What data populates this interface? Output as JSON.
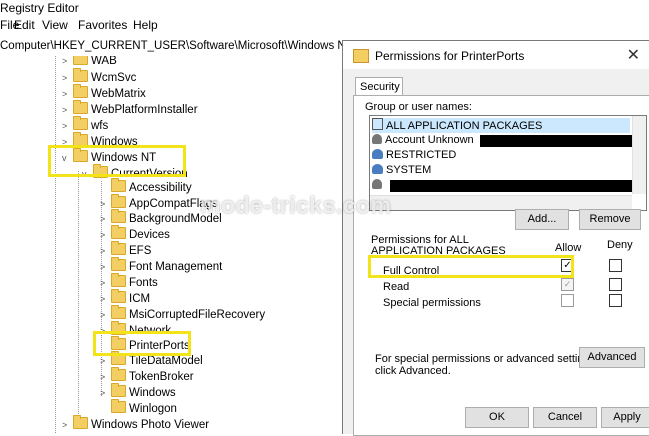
{
  "window": {
    "title": "Registry Editor"
  },
  "menu": [
    "File",
    "Edit",
    "View",
    "Favorites",
    "Help"
  ],
  "address": "Computer\\HKEY_CURRENT_USER\\Software\\Microsoft\\Windows NT\\CurrentVersion\\PrinterPorts",
  "tree": {
    "items": [
      {
        "label": "WAB"
      },
      {
        "label": "WcmSvc"
      },
      {
        "label": "WebMatrix"
      },
      {
        "label": "WebPlatformInstaller"
      },
      {
        "label": "wfs"
      },
      {
        "label": "Windows"
      },
      {
        "label": "Windows NT"
      },
      {
        "label": "CurrentVersion"
      },
      {
        "label": "Accessibility"
      },
      {
        "label": "AppCompatFlags"
      },
      {
        "label": "BackgroundModel"
      },
      {
        "label": "Devices"
      },
      {
        "label": "EFS"
      },
      {
        "label": "Font Management"
      },
      {
        "label": "Fonts"
      },
      {
        "label": "ICM"
      },
      {
        "label": "MsiCorruptedFileRecovery"
      },
      {
        "label": "Network"
      },
      {
        "label": "PrinterPorts"
      },
      {
        "label": "TileDataModel"
      },
      {
        "label": "TokenBroker"
      },
      {
        "label": "Windows"
      },
      {
        "label": "Winlogon"
      },
      {
        "label": "Windows Photo Viewer"
      }
    ]
  },
  "dialog": {
    "title": "Permissions for PrinterPorts",
    "tab": "Security",
    "group_label": "Group or user names:",
    "users": [
      {
        "name": "ALL APPLICATION PACKAGES"
      },
      {
        "name": "Account Unknown"
      },
      {
        "name": "RESTRICTED"
      },
      {
        "name": "SYSTEM"
      },
      {
        "name": ""
      }
    ],
    "add_button": "Add...",
    "remove_button": "Remove",
    "perm_label_1": "Permissions for ALL",
    "perm_label_2": "APPLICATION PACKAGES",
    "allow_header": "Allow",
    "deny_header": "Deny",
    "permissions": [
      {
        "name": "Full Control",
        "allow": true,
        "deny": false
      },
      {
        "name": "Read",
        "allow": true,
        "deny": false
      },
      {
        "name": "Special permissions",
        "allow": false,
        "deny": false
      }
    ],
    "advanced_text_1": "For special permissions or advanced settings,",
    "advanced_text_2": "click Advanced.",
    "advanced_button": "Advanced",
    "ok_button": "OK",
    "cancel_button": "Cancel",
    "apply_button": "Apply"
  },
  "watermark": "mode-tricks.com",
  "highlight_color": "#f2e418"
}
